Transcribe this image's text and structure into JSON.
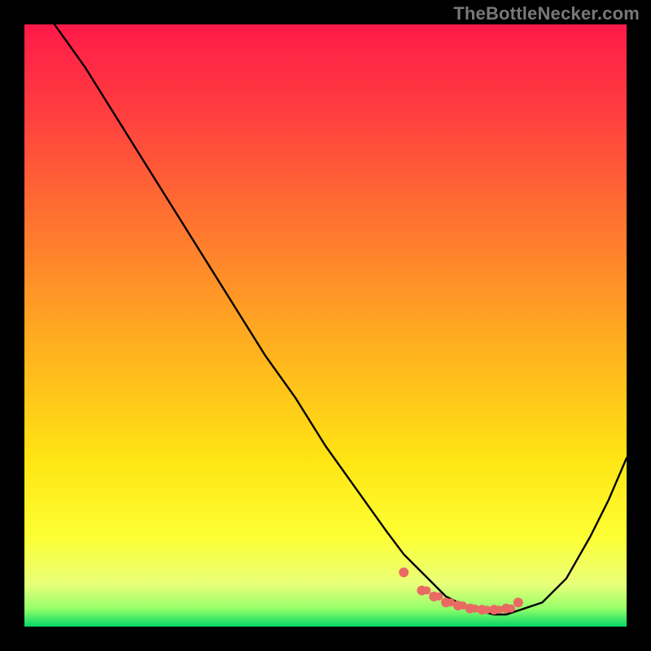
{
  "watermark": "TheBottleNecker.com",
  "colors": {
    "frame": "#000000",
    "watermark": "#787878",
    "curve": "#000000",
    "dots": "#e96a63",
    "gradient_stops": [
      {
        "offset": 0,
        "color": "#ff1a49"
      },
      {
        "offset": 15,
        "color": "#ff3f3f"
      },
      {
        "offset": 35,
        "color": "#ff7a2e"
      },
      {
        "offset": 55,
        "color": "#ffb41e"
      },
      {
        "offset": 72,
        "color": "#ffe413"
      },
      {
        "offset": 85,
        "color": "#fdff33"
      },
      {
        "offset": 93,
        "color": "#e8ff7a"
      },
      {
        "offset": 97,
        "color": "#95ff6a"
      },
      {
        "offset": 100,
        "color": "#05d865"
      }
    ]
  },
  "chart_data": {
    "type": "line",
    "title": "",
    "xlabel": "",
    "ylabel": "",
    "xlim": [
      0,
      100
    ],
    "ylim": [
      0,
      100
    ],
    "grid": false,
    "legend": false,
    "series": [
      {
        "name": "bottleneck-curve",
        "x": [
          5,
          10,
          15,
          20,
          25,
          30,
          35,
          40,
          45,
          50,
          55,
          60,
          63,
          66,
          70,
          74,
          78,
          80,
          83,
          86,
          90,
          94,
          97,
          100
        ],
        "y": [
          100,
          93,
          85,
          77,
          69,
          61,
          53,
          45,
          38,
          30,
          23,
          16,
          12,
          9,
          5,
          3,
          2,
          2,
          3,
          4,
          8,
          15,
          21,
          28
        ]
      }
    ],
    "marker_points": {
      "name": "highlight-dots",
      "x": [
        63,
        66,
        68,
        70,
        72,
        74,
        76,
        78,
        80,
        82
      ],
      "y": [
        9,
        6,
        5,
        4,
        3.5,
        3,
        2.8,
        2.8,
        3,
        4
      ]
    }
  }
}
